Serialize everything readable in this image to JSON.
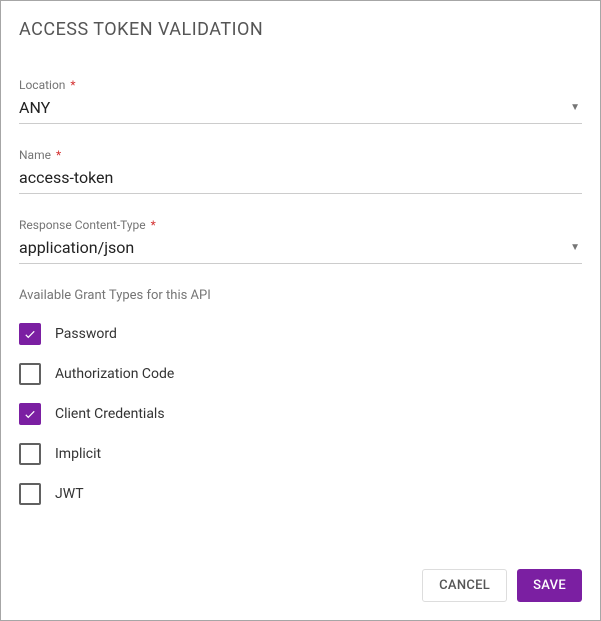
{
  "title": "ACCESS TOKEN VALIDATION",
  "fields": {
    "location": {
      "label": "Location",
      "value": "ANY",
      "required": true,
      "type": "select"
    },
    "name": {
      "label": "Name",
      "value": "access-token",
      "required": true,
      "type": "text"
    },
    "contentType": {
      "label": "Response Content-Type",
      "value": "application/json",
      "required": true,
      "type": "select"
    }
  },
  "grantSection": {
    "label": "Available Grant Types for this API",
    "options": [
      {
        "label": "Password",
        "checked": true
      },
      {
        "label": "Authorization Code",
        "checked": false
      },
      {
        "label": "Client Credentials",
        "checked": true
      },
      {
        "label": "Implicit",
        "checked": false
      },
      {
        "label": "JWT",
        "checked": false
      }
    ]
  },
  "actions": {
    "cancel": "CANCEL",
    "save": "SAVE"
  },
  "requiredMark": "*",
  "colors": {
    "accent": "#7b1fa2"
  }
}
